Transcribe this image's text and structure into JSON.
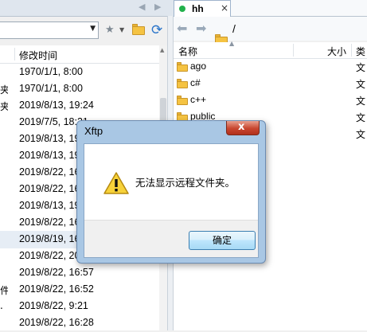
{
  "tab": {
    "name": "hh",
    "close": "×"
  },
  "left_pane": {
    "column_header": "修改时间",
    "rows": [
      {
        "tail": "",
        "date": "1970/1/1, 8:00"
      },
      {
        "tail": "夹",
        "date": "1970/1/1, 8:00"
      },
      {
        "tail": "夹",
        "date": "2019/8/13, 19:24"
      },
      {
        "tail": "",
        "date": "2019/7/5, 18:31"
      },
      {
        "tail": "",
        "date": "2019/8/13, 19"
      },
      {
        "tail": "",
        "date": "2019/8/13, 19"
      },
      {
        "tail": "",
        "date": "2019/8/22, 16"
      },
      {
        "tail": "",
        "date": "2019/8/22, 16"
      },
      {
        "tail": "",
        "date": "2019/8/13, 19"
      },
      {
        "tail": "",
        "date": "2019/8/22, 16"
      },
      {
        "tail": "",
        "date": "2019/8/19, 16"
      },
      {
        "tail": "",
        "date": "2019/8/22, 20"
      },
      {
        "tail": "",
        "date": "2019/8/22, 16:57"
      },
      {
        "tail": "件",
        "date": "2019/8/22, 16:52"
      },
      {
        "tail": ".",
        "date": "2019/8/22, 9:21"
      },
      {
        "tail": "",
        "date": "2019/8/22, 16:28"
      }
    ]
  },
  "right_pane": {
    "path": "/",
    "headers": {
      "name": "名称",
      "size": "大小",
      "type": "类"
    },
    "rows": [
      {
        "name": "ago",
        "type": "文"
      },
      {
        "name": "c#",
        "type": "文"
      },
      {
        "name": "c++",
        "type": "文"
      },
      {
        "name": "public",
        "type": "文"
      },
      {
        "name": "",
        "type": "文"
      }
    ]
  },
  "dialog": {
    "title": "Xftp",
    "message": "无法显示远程文件夹。",
    "ok_label": "确定",
    "close_glyph": "x"
  },
  "colors": {
    "accent": "#2a74c9",
    "folder": "#f5c342",
    "tab_dot": "#22b14c",
    "close": "#c8462f"
  }
}
